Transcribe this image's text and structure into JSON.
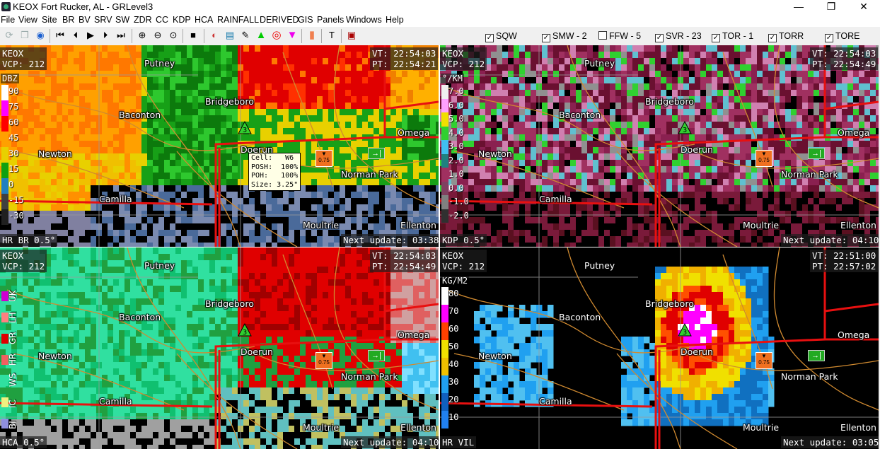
{
  "window": {
    "title": "KEOX Fort Rucker, AL - GRLevel3",
    "minimize": "—",
    "restore": "❐",
    "close": "✕"
  },
  "menu": [
    "File",
    "View",
    "Site",
    "BR",
    "BV",
    "SRV",
    "SW",
    "ZDR",
    "CC",
    "KDP",
    "HCA",
    "RAINFALL",
    "DERIVED",
    "GIS",
    "Panels",
    "Windows",
    "Help"
  ],
  "toolbar": {
    "checks": [
      {
        "label": "SQW",
        "checked": true
      },
      {
        "label": "SMW - 2",
        "checked": true
      },
      {
        "label": "FFW - 5",
        "checked": false
      },
      {
        "label": "SVR - 23",
        "checked": true
      },
      {
        "label": "TOR - 1",
        "checked": true
      },
      {
        "label": "TORR",
        "checked": true
      },
      {
        "label": "TORE",
        "checked": true
      }
    ]
  },
  "cities": {
    "putney": "Putney",
    "bridgeboro": "Bridgeboro",
    "baconton": "Baconton",
    "omega": "Omega",
    "newton": "Newton",
    "doerun": "Doerun",
    "norman_park": "Norman Park",
    "camilla": "Camilla",
    "moultrie": "Moultrie",
    "ellenton": "Ellenton"
  },
  "panels": {
    "br": {
      "site": "KEOX",
      "vcp": "VCP: 212",
      "vt": "VT: 22:54:03",
      "pt": "PT: 22:54:21",
      "product": "HR BR 0.5°",
      "next_update": "Next update: 03:38",
      "unit": "DBZ",
      "ticks": [
        "90",
        "75",
        "60",
        "45",
        "30",
        "15",
        "0",
        "-15",
        "-30"
      ]
    },
    "kdp": {
      "site": "KEOX",
      "vcp": "VCP: 212",
      "vt": "VT: 22:54:03",
      "pt": "PT: 22:54:49",
      "product": "KDP 0.5°",
      "next_update": "Next update: 04:10",
      "unit": "°/KM",
      "ticks": [
        "7.0",
        "6.0",
        "5.0",
        "4.0",
        "3.0",
        "2.0",
        "1.0",
        "0.0",
        "-1.0",
        "-2.0"
      ]
    },
    "hca": {
      "site": "KEOX",
      "vcp": "VCP: 212",
      "vt": "VT: 22:54:03",
      "pt": "PT: 22:54:49",
      "product": "HCA 0.5°",
      "next_update": "Next update: 04:10",
      "categories": [
        "UK",
        "LH",
        "GR",
        "HR",
        "WS",
        "IC",
        "BI"
      ]
    },
    "vil": {
      "site": "KEOX",
      "vcp": "VCP: 212",
      "vt": "VT: 22:51:00",
      "pt": "PT: 22:57:02",
      "product": "HR VIL",
      "next_update": "Next update: 03:05",
      "unit": "KG/M2",
      "ticks": [
        "80",
        "70",
        "60",
        "50",
        "40",
        "30",
        "20",
        "10"
      ]
    }
  },
  "cell_info": {
    "line1": "Cell:   W6",
    "line2": "POSH:  100%",
    "line3": "POH:   100%",
    "line4": "Size: 3.25\""
  },
  "storm_id": "3",
  "hail_marker": "0.75",
  "arrow_marker": "→|",
  "colors": {
    "warning_red": "#e81010",
    "road": "#d08a30",
    "county": "#9a9a9a"
  }
}
